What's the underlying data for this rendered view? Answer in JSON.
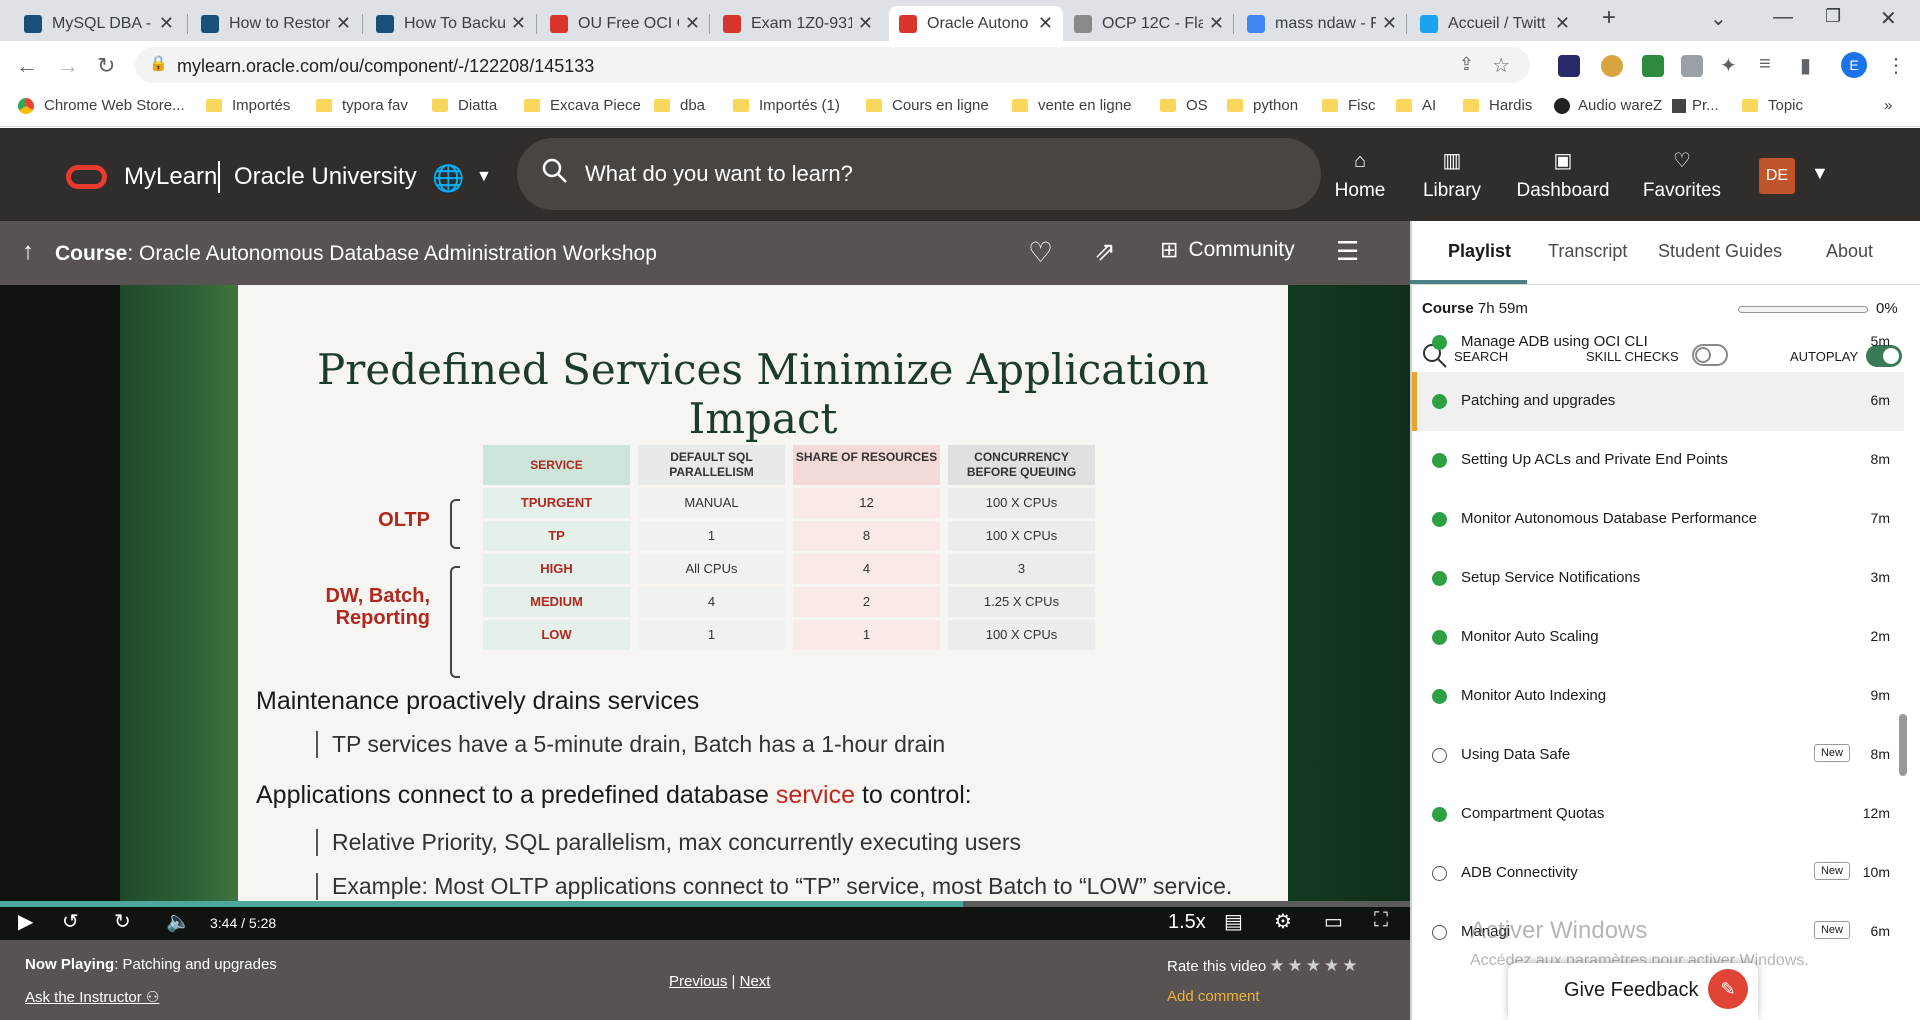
{
  "browser": {
    "tabs": [
      {
        "title": "MySQL DBA -",
        "fav_color": "#1c4e7a"
      },
      {
        "title": "How to Restor",
        "fav_color": "#1c4e7a"
      },
      {
        "title": "How To Backu",
        "fav_color": "#1c4e7a"
      },
      {
        "title": "OU Free OCI C",
        "fav_color": "#d9362b"
      },
      {
        "title": "Exam 1Z0-931",
        "fav_color": "#d9362b"
      },
      {
        "title": "Oracle Autono",
        "fav_color": "#d9362b"
      },
      {
        "title": "OCP 12C - Fla",
        "fav_color": "#8a8a8a"
      },
      {
        "title": "mass ndaw - F",
        "fav_color": "#4285f4"
      },
      {
        "title": "Accueil / Twitt",
        "fav_color": "#1da1f2"
      }
    ],
    "active_tab_index": 5,
    "url": "mylearn.oracle.com/ou/component/-/122208/145133",
    "profile_initial": "E",
    "bookmarks": [
      "Chrome Web Store...",
      "Importés",
      "typora fav",
      "Diatta",
      "Excava Piece",
      "dba",
      "Importés (1)",
      "Cours en ligne",
      "vente en ligne",
      "OS",
      "python",
      "Fisc",
      "AI",
      "Hardis",
      "Audio wareZ",
      "Pr...",
      "Topic"
    ],
    "more_bookmarks": "»"
  },
  "header": {
    "brand": "MyLearn",
    "org": "Oracle University",
    "search_placeholder": "What do you want to learn?",
    "nav": [
      {
        "label": "Home",
        "icon": "home-icon"
      },
      {
        "label": "Library",
        "icon": "library-icon"
      },
      {
        "label": "Dashboard",
        "icon": "dashboard-icon"
      },
      {
        "label": "Favorites",
        "icon": "heart-icon"
      }
    ],
    "avatar": "DE",
    "brand_color": "#e83a2f"
  },
  "course": {
    "prefix": "Course",
    "title": ": Oracle Autonomous Database Administration Workshop",
    "community": "Community"
  },
  "slide": {
    "title": "Predefined Services Minimize Application Impact",
    "groups": [
      "OLTP",
      "DW, Batch, Reporting"
    ],
    "table": {
      "headers": [
        "SERVICE",
        "DEFAULT SQL PARALLELISM",
        "SHARE OF RESOURCES",
        "CONCURRENCY BEFORE QUEUING"
      ],
      "rows": [
        [
          "TPURGENT",
          "MANUAL",
          "12",
          "100 X CPUs"
        ],
        [
          "TP",
          "1",
          "8",
          "100 X CPUs"
        ],
        [
          "HIGH",
          "All CPUs",
          "4",
          "3"
        ],
        [
          "MEDIUM",
          "4",
          "2",
          "1.25 X CPUs"
        ],
        [
          "LOW",
          "1",
          "1",
          "100 X CPUs"
        ]
      ]
    },
    "bullet1": "Maintenance proactively drains services",
    "sub1": "TP services have a 5-minute drain, Batch has a 1-hour drain",
    "bullet2_a": "Applications connect to a predefined database",
    "bullet2_b": "service",
    "bullet2_c": "to control:",
    "sub2": "Relative Priority, SQL parallelism, max concurrently executing users",
    "sub3": "Example: Most OLTP applications connect to “TP” service, most Batch to “LOW” service."
  },
  "player": {
    "current_time": "3:44",
    "duration": "5:28",
    "progress_fraction": 0.683,
    "speed": "1.5x",
    "skip_back": "10",
    "skip_fwd": "10"
  },
  "footer": {
    "now_playing_label": "Now Playing",
    "now_playing": ": Patching and upgrades",
    "ask": "Ask the Instructor",
    "previous": "Previous",
    "sep": "|",
    "next": "Next",
    "rate": "Rate this video",
    "add_comment": "Add comment"
  },
  "panel": {
    "tabs": [
      "Playlist",
      "Transcript",
      "Student Guides",
      "About"
    ],
    "course_label": "Course",
    "course_length": "7h 59m",
    "progress_pct": "0%",
    "search": "SEARCH",
    "skill_checks": "SKILL CHECKS",
    "autoplay": "AUTOPLAY",
    "skill_checks_on": false,
    "autoplay_on": true,
    "items": [
      {
        "title": "Manage ADB using OCI CLI",
        "duration": "5m",
        "done": true,
        "current": false,
        "badge": ""
      },
      {
        "title": "Patching and upgrades",
        "duration": "6m",
        "done": true,
        "current": true,
        "badge": ""
      },
      {
        "title": "Setting Up ACLs and Private End Points",
        "duration": "8m",
        "done": true,
        "current": false,
        "badge": ""
      },
      {
        "title": "Monitor Autonomous Database Performance",
        "duration": "7m",
        "done": true,
        "current": false,
        "badge": ""
      },
      {
        "title": "Setup Service Notifications",
        "duration": "3m",
        "done": true,
        "current": false,
        "badge": ""
      },
      {
        "title": "Monitor Auto Scaling",
        "duration": "2m",
        "done": true,
        "current": false,
        "badge": ""
      },
      {
        "title": "Monitor Auto Indexing",
        "duration": "9m",
        "done": true,
        "current": false,
        "badge": ""
      },
      {
        "title": "Using Data Safe",
        "duration": "8m",
        "done": false,
        "current": false,
        "badge": "New"
      },
      {
        "title": "Compartment Quotas",
        "duration": "12m",
        "done": true,
        "current": false,
        "badge": ""
      },
      {
        "title": "ADB Connectivity",
        "duration": "10m",
        "done": false,
        "current": false,
        "badge": "New"
      },
      {
        "title": "Managi",
        "duration": "6m",
        "done": false,
        "current": false,
        "badge": "New"
      }
    ]
  },
  "overlay": {
    "watermark_title": "Activer Windows",
    "watermark_sub": "Accédez aux paramètres pour activer Windows.",
    "feedback": "Give Feedback"
  }
}
